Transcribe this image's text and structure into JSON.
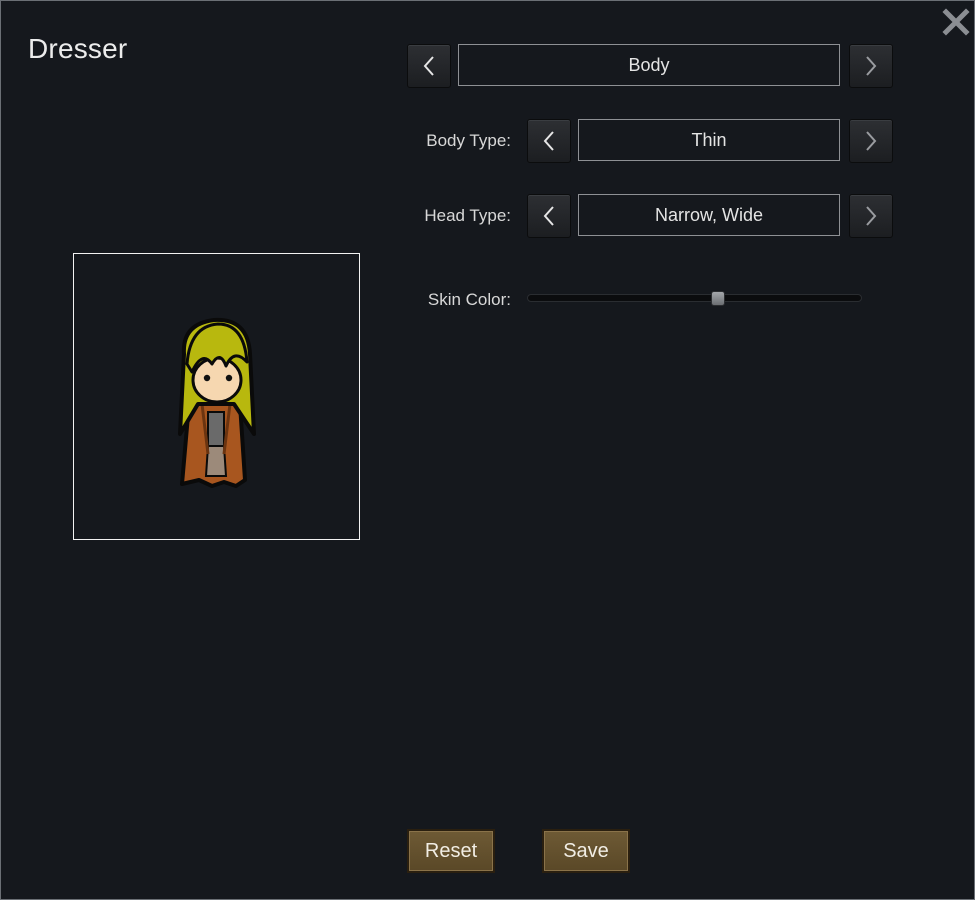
{
  "window": {
    "title": "Dresser",
    "close_icon": "close-icon"
  },
  "category": {
    "value": "Body",
    "prev_icon": "chevron-left-icon",
    "next_icon": "chevron-right-icon"
  },
  "body_type": {
    "label": "Body Type:",
    "value": "Thin"
  },
  "head_type": {
    "label": "Head Type:",
    "value": "Narrow, Wide"
  },
  "skin_color": {
    "label": "Skin Color:",
    "slider_value": 0.57
  },
  "actions": {
    "reset_label": "Reset",
    "save_label": "Save"
  },
  "colors": {
    "background": "#15181d",
    "button_brown": "#6e5a35",
    "hair": "#b8b80e",
    "coat": "#a8561f",
    "skin": "#f6d7b0"
  }
}
